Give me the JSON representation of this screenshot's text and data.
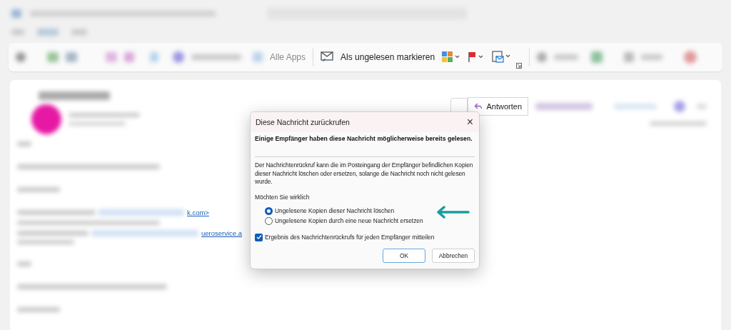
{
  "toolbar": {
    "apps_label": "Alle Apps",
    "mark_unread_label": "Als ungelesen markieren"
  },
  "reading_pane": {
    "reply_label": "Antworten",
    "links": [
      "k.com>",
      "ueroservice.a"
    ]
  },
  "dialog": {
    "title": "Diese Nachricht zurückrufen",
    "close": "×",
    "warning": "Einige Empfänger haben diese Nachricht möglicherweise bereits gelesen.",
    "description": "Der Nachrichtenrückruf kann die im Posteingang der Empfänger befindlichen Kopien dieser Nachricht löschen oder ersetzen, solange die Nachricht noch nicht gelesen wurde.",
    "question": "Möchten Sie wirklich",
    "options": [
      {
        "label": "Ungelesene Kopien dieser Nachricht löschen",
        "selected": true
      },
      {
        "label": "Ungelesene Kopien durch eine neue Nachricht ersetzen",
        "selected": false
      }
    ],
    "notify": {
      "label": "Ergebnis des Nachrichtenrückrufs für jeden Empfänger mitteilen",
      "checked": true
    },
    "buttons": [
      {
        "label": "OK",
        "kind": "primary"
      },
      {
        "label": "Abbrechen",
        "kind": "secondary"
      }
    ]
  }
}
